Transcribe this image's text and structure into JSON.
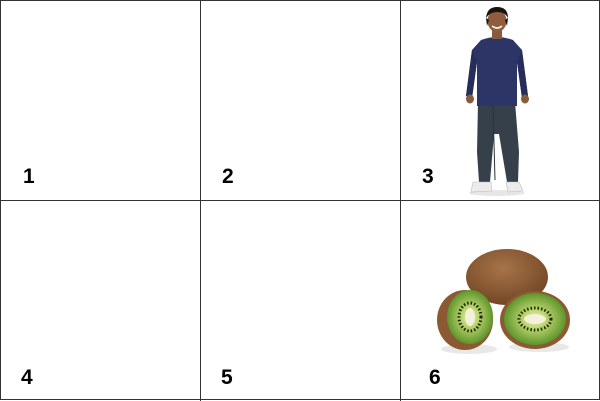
{
  "cells": [
    {
      "number": "1",
      "content": "empty"
    },
    {
      "number": "2",
      "content": "empty"
    },
    {
      "number": "3",
      "content": "person-standing"
    },
    {
      "number": "4",
      "content": "empty"
    },
    {
      "number": "5",
      "content": "empty"
    },
    {
      "number": "6",
      "content": "kiwi-fruit"
    }
  ],
  "colors": {
    "grid_line": "#333333",
    "background": "#ffffff",
    "sweater": "#2c3566",
    "jeans": "#35404a",
    "kiwi_skin": "#8b5a33",
    "kiwi_flesh": "#5f9a2a"
  }
}
